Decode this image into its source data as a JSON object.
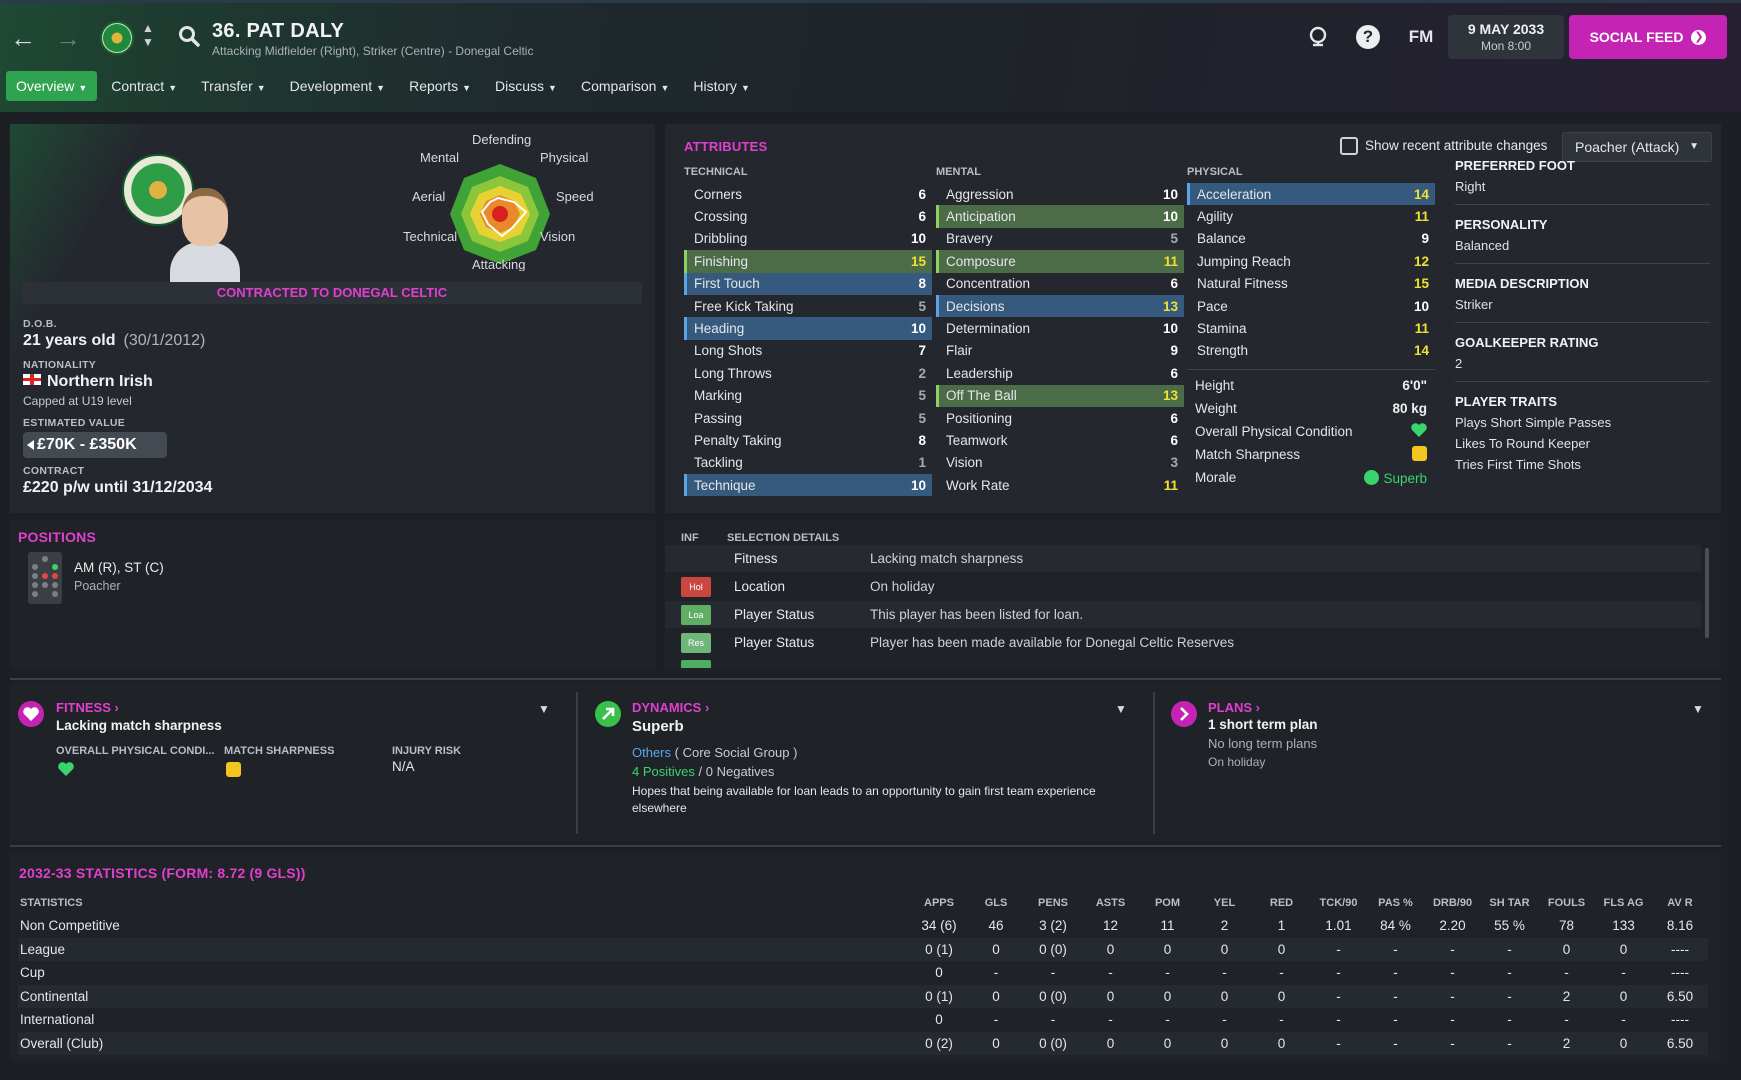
{
  "header": {
    "player_title": "36. PAT DALY",
    "player_subtitle": "Attacking Midfielder (Right), Striker (Centre) - Donegal Celtic",
    "top_icon_fm": "FM",
    "date": "9 MAY 2033",
    "time": "Mon 8:00",
    "social_label": "SOCIAL FEED",
    "colors": {
      "accent": "#c423b3",
      "active_tab": "#2fa34f"
    }
  },
  "tabs": [
    {
      "label": "Overview"
    },
    {
      "label": "Contract"
    },
    {
      "label": "Transfer"
    },
    {
      "label": "Development"
    },
    {
      "label": "Reports"
    },
    {
      "label": "Discuss"
    },
    {
      "label": "Comparison"
    },
    {
      "label": "History"
    }
  ],
  "profile": {
    "radar_labels": {
      "top": "Defending",
      "tl": "Mental",
      "tr": "Physical",
      "l": "Aerial",
      "r": "Speed",
      "bl": "Technical",
      "br": "Vision",
      "bottom": "Attacking"
    },
    "contract_banner": "CONTRACTED TO DONEGAL CELTIC",
    "dob_label": "D.O.B.",
    "age": "21 years old",
    "dob": "(30/1/2012)",
    "nationality_label": "NATIONALITY",
    "nationality": "Northern Irish",
    "capped": "Capped at U19 level",
    "value_label": "ESTIMATED VALUE",
    "value": "£70K - £350K",
    "contract_label": "CONTRACT",
    "contract": "£220 p/w until 31/12/2034"
  },
  "attributes": {
    "heading": "ATTRIBUTES",
    "show_changes_label": "Show recent attribute changes",
    "role_dropdown": "Poacher (Attack)",
    "technical_label": "TECHNICAL",
    "mental_label": "MENTAL",
    "physical_label": "PHYSICAL",
    "technical": [
      {
        "name": "Corners",
        "value": "6",
        "hl": "",
        "c": "w"
      },
      {
        "name": "Crossing",
        "value": "6",
        "hl": "",
        "c": "w"
      },
      {
        "name": "Dribbling",
        "value": "10",
        "hl": "",
        "c": "w"
      },
      {
        "name": "Finishing",
        "value": "15",
        "hl": "green",
        "c": "y"
      },
      {
        "name": "First Touch",
        "value": "8",
        "hl": "blue",
        "c": "w"
      },
      {
        "name": "Free Kick Taking",
        "value": "5",
        "hl": "",
        "c": "g"
      },
      {
        "name": "Heading",
        "value": "10",
        "hl": "blue",
        "c": "w"
      },
      {
        "name": "Long Shots",
        "value": "7",
        "hl": "",
        "c": "w"
      },
      {
        "name": "Long Throws",
        "value": "2",
        "hl": "",
        "c": "g"
      },
      {
        "name": "Marking",
        "value": "5",
        "hl": "",
        "c": "g"
      },
      {
        "name": "Passing",
        "value": "5",
        "hl": "",
        "c": "g"
      },
      {
        "name": "Penalty Taking",
        "value": "8",
        "hl": "",
        "c": "w"
      },
      {
        "name": "Tackling",
        "value": "1",
        "hl": "",
        "c": "g"
      },
      {
        "name": "Technique",
        "value": "10",
        "hl": "blue",
        "c": "w"
      }
    ],
    "mental": [
      {
        "name": "Aggression",
        "value": "10",
        "hl": "",
        "c": "w"
      },
      {
        "name": "Anticipation",
        "value": "10",
        "hl": "green",
        "c": "w"
      },
      {
        "name": "Bravery",
        "value": "5",
        "hl": "",
        "c": "g"
      },
      {
        "name": "Composure",
        "value": "11",
        "hl": "green",
        "c": "y"
      },
      {
        "name": "Concentration",
        "value": "6",
        "hl": "",
        "c": "w"
      },
      {
        "name": "Decisions",
        "value": "13",
        "hl": "blue",
        "c": "y"
      },
      {
        "name": "Determination",
        "value": "10",
        "hl": "",
        "c": "w"
      },
      {
        "name": "Flair",
        "value": "9",
        "hl": "",
        "c": "w"
      },
      {
        "name": "Leadership",
        "value": "6",
        "hl": "",
        "c": "w"
      },
      {
        "name": "Off The Ball",
        "value": "13",
        "hl": "green",
        "c": "y"
      },
      {
        "name": "Positioning",
        "value": "6",
        "hl": "",
        "c": "w"
      },
      {
        "name": "Teamwork",
        "value": "6",
        "hl": "",
        "c": "w"
      },
      {
        "name": "Vision",
        "value": "3",
        "hl": "",
        "c": "g"
      },
      {
        "name": "Work Rate",
        "value": "11",
        "hl": "",
        "c": "y"
      }
    ],
    "physical": [
      {
        "name": "Acceleration",
        "value": "14",
        "hl": "blue",
        "c": "y"
      },
      {
        "name": "Agility",
        "value": "11",
        "hl": "",
        "c": "y"
      },
      {
        "name": "Balance",
        "value": "9",
        "hl": "",
        "c": "w"
      },
      {
        "name": "Jumping Reach",
        "value": "12",
        "hl": "",
        "c": "y"
      },
      {
        "name": "Natural Fitness",
        "value": "15",
        "hl": "",
        "c": "y"
      },
      {
        "name": "Pace",
        "value": "10",
        "hl": "",
        "c": "w"
      },
      {
        "name": "Stamina",
        "value": "11",
        "hl": "",
        "c": "y"
      },
      {
        "name": "Strength",
        "value": "14",
        "hl": "",
        "c": "y"
      }
    ],
    "height_label": "Height",
    "height": "6'0\"",
    "weight_label": "Weight",
    "weight": "80 kg",
    "opc_label": "Overall Physical Condition",
    "sharpness_label": "Match Sharpness",
    "morale_label": "Morale",
    "morale": "Superb",
    "preferred_foot_label": "PREFERRED FOOT",
    "preferred_foot": "Right",
    "personality_label": "PERSONALITY",
    "personality": "Balanced",
    "media_label": "MEDIA DESCRIPTION",
    "media": "Striker",
    "gk_label": "GOALKEEPER RATING",
    "gk": "2",
    "traits_label": "PLAYER TRAITS",
    "traits": [
      "Plays Short Simple Passes",
      "Likes To Round Keeper",
      "Tries First Time Shots"
    ]
  },
  "positions": {
    "heading": "POSITIONS",
    "positions": "AM (R), ST (C)",
    "role": "Poacher"
  },
  "selection": {
    "inf_label": "INF",
    "details_label": "SELECTION DETAILS",
    "rows": [
      {
        "tag": "",
        "key": "Fitness",
        "value": "Lacking match sharpness"
      },
      {
        "tag": "Hol",
        "key": "Location",
        "value": "On holiday"
      },
      {
        "tag": "Loa",
        "key": "Player Status",
        "value": "This player has been listed for loan."
      },
      {
        "tag": "Res",
        "key": "Player Status",
        "value": "Player has been made available for Donegal Celtic Reserves"
      }
    ]
  },
  "fitness": {
    "title": "FITNESS",
    "headline": "Lacking match sharpness",
    "opc_label": "OVERALL PHYSICAL CONDI...",
    "ms_label": "MATCH SHARPNESS",
    "injury_label": "INJURY RISK",
    "injury": "N/A"
  },
  "dynamics": {
    "title": "DYNAMICS",
    "headline": "Superb",
    "group_link": "Others",
    "group_rest": "( Core Social Group )",
    "positives": "4 Positives",
    "slash": "/",
    "negatives": "0 Negatives",
    "desc": "Hopes that being available for loan leads to an opportunity to gain first team experience elsewhere"
  },
  "plans": {
    "title": "PLANS",
    "headline": "1 short term plan",
    "line1": "No long term plans",
    "line2": "On holiday"
  },
  "stats": {
    "heading": "2032-33 STATISTICS (FORM: 8.72 (9 GLS))",
    "columns": [
      "STATISTICS",
      "APPS",
      "GLS",
      "PENS",
      "ASTS",
      "POM",
      "YEL",
      "RED",
      "TCK/90",
      "PAS %",
      "DRB/90",
      "SH TAR",
      "FOULS",
      "FLS AG",
      "AV R"
    ],
    "rows": [
      [
        "Non Competitive",
        "34 (6)",
        "46",
        "3 (2)",
        "12",
        "11",
        "2",
        "1",
        "1.01",
        "84 %",
        "2.20",
        "55 %",
        "78",
        "133",
        "8.16"
      ],
      [
        "League",
        "0 (1)",
        "0",
        "0 (0)",
        "0",
        "0",
        "0",
        "0",
        "-",
        "-",
        "-",
        "-",
        "0",
        "0",
        "----"
      ],
      [
        "Cup",
        "0",
        "-",
        "-",
        "-",
        "-",
        "-",
        "-",
        "-",
        "-",
        "-",
        "-",
        "-",
        "-",
        "----"
      ],
      [
        "Continental",
        "0 (1)",
        "0",
        "0 (0)",
        "0",
        "0",
        "0",
        "0",
        "-",
        "-",
        "-",
        "-",
        "2",
        "0",
        "6.50"
      ],
      [
        "International",
        "0",
        "-",
        "-",
        "-",
        "-",
        "-",
        "-",
        "-",
        "-",
        "-",
        "-",
        "-",
        "-",
        "----"
      ],
      [
        "Overall (Club)",
        "0 (2)",
        "0",
        "0 (0)",
        "0",
        "0",
        "0",
        "0",
        "-",
        "-",
        "-",
        "-",
        "2",
        "0",
        "6.50"
      ]
    ]
  }
}
